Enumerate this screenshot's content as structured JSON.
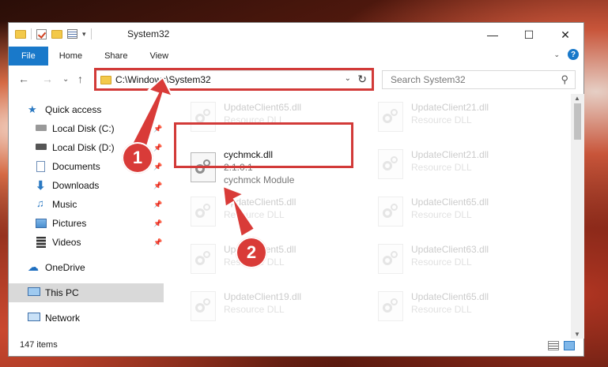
{
  "window": {
    "title": "System32"
  },
  "title_controls": {
    "minimize": "—",
    "maximize": "☐",
    "close": "✕",
    "customize": "▾"
  },
  "ribbon": {
    "tabs": [
      "File",
      "Home",
      "Share",
      "View"
    ],
    "collapse": "⌄",
    "help": "?"
  },
  "nav": {
    "back": "←",
    "forward": "→",
    "recent": "⌄",
    "up": "↑"
  },
  "address": {
    "path": "C:\\Windows\\System32",
    "dropdown": "⌄",
    "refresh": "↻"
  },
  "search": {
    "placeholder": "Search System32",
    "icon": "⚲"
  },
  "sidebar": {
    "items": [
      {
        "label": "Quick access",
        "icon": "star-icon"
      },
      {
        "label": "Local Disk (C:)",
        "icon": "drive-icon",
        "pin": "📌"
      },
      {
        "label": "Local Disk (D:)",
        "icon": "drive-icon",
        "pin": "📌"
      },
      {
        "label": "Documents",
        "icon": "documents-icon",
        "pin": "📌"
      },
      {
        "label": "Downloads",
        "icon": "downloads-icon",
        "pin": "📌"
      },
      {
        "label": "Music",
        "icon": "music-icon",
        "pin": "📌"
      },
      {
        "label": "Pictures",
        "icon": "pictures-icon",
        "pin": "📌"
      },
      {
        "label": "Videos",
        "icon": "videos-icon",
        "pin": "📌"
      },
      {
        "label": "OneDrive",
        "icon": "cloud-icon"
      },
      {
        "label": "This PC",
        "icon": "computer-icon"
      },
      {
        "label": "Network",
        "icon": "network-icon"
      }
    ]
  },
  "files": [
    {
      "name": "UpdateClient65.dll",
      "sub": "Resource DLL"
    },
    {
      "name": "UpdateClient21.dll",
      "sub": "Resource DLL"
    },
    {
      "name": "UpdateClient21.dll",
      "sub": "Resource DLL"
    },
    {
      "name": "UpdateClient5.dll",
      "sub": "Resource DLL"
    },
    {
      "name": "UpdateClient65.dll",
      "sub": "Resource DLL"
    },
    {
      "name": "UpdateClient5.dll",
      "sub": "Resource DLL"
    },
    {
      "name": "UpdateClient63.dll",
      "sub": "Resource DLL"
    },
    {
      "name": "UpdateClient19.dll",
      "sub": "Resource DLL"
    },
    {
      "name": "UpdateClient65.dll",
      "sub": "Resource DLL"
    }
  ],
  "selected_file": {
    "name": "cychmck.dll",
    "version": "2.1.0.1",
    "description": "cychmck Module"
  },
  "scroll": {
    "up": "▲",
    "down": "▼"
  },
  "status": {
    "count": "147 items"
  },
  "callouts": [
    "1",
    "2"
  ],
  "colors": {
    "accent": "#1979ca",
    "highlight": "#d23a38"
  }
}
